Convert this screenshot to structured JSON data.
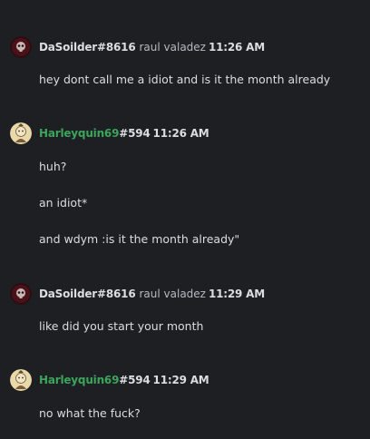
{
  "colors": {
    "background": "#1e1f22",
    "text": "#dbdee1",
    "muted": "#b5bac1",
    "user_white": "#dbdee1",
    "user_green": "#3ba55c"
  },
  "messages": [
    {
      "author": "DaSoilder",
      "tag": "#8616",
      "nickname": "raul valadez",
      "time": "11:26 AM",
      "avatar_icon": "dark-skull-avatar",
      "lines": [
        "hey dont call me a idiot and is it the month already"
      ]
    },
    {
      "author": "Harleyquin69",
      "tag": "#594",
      "nickname": "",
      "time": "11:26 AM",
      "avatar_icon": "cartoon-character-avatar",
      "lines": [
        "huh?",
        "an idiot*",
        "and wdym :is it the month already\""
      ]
    },
    {
      "author": "DaSoilder",
      "tag": "#8616",
      "nickname": "raul valadez",
      "time": "11:29 AM",
      "avatar_icon": "dark-skull-avatar",
      "lines": [
        "like did you start your month"
      ]
    },
    {
      "author": "Harleyquin69",
      "tag": "#594",
      "nickname": "",
      "time": "11:29 AM",
      "avatar_icon": "cartoon-character-avatar",
      "lines": [
        "no what the fuck?"
      ]
    }
  ]
}
